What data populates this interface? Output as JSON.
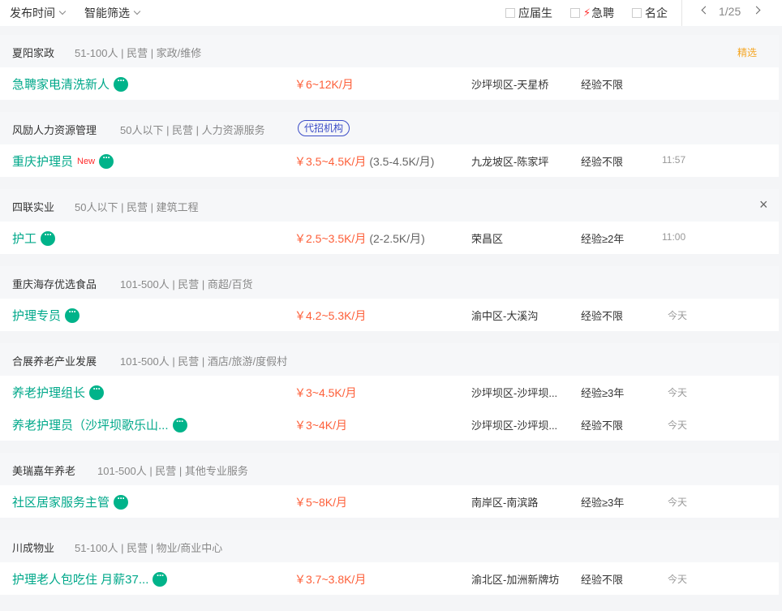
{
  "filters": {
    "publish_time": "发布时间",
    "smart_filter": "智能筛选",
    "fresh_grad": "应届生",
    "urgent": "急聘",
    "famous": "名企",
    "page": "1/25"
  },
  "cards": [
    {
      "company": "夏阳家政",
      "meta": "51-100人 | 民营 | 家政/维修",
      "featured": "精选",
      "jobs": [
        {
          "title": "急聘家电清洗新人",
          "salary": "￥6~12K/月",
          "location": "沙坪坝区-天星桥",
          "experience": "经验不限"
        }
      ]
    },
    {
      "company": "风励人力资源管理",
      "meta": "50人以下 | 民营 | 人力资源服务",
      "agency": "代招机构",
      "jobs": [
        {
          "title": "重庆护理员",
          "new": "New",
          "salary": "￥3.5~4.5K/月",
          "salary_sub": "(3.5-4.5K/月)",
          "location": "九龙坡区-陈家坪",
          "experience": "经验不限",
          "time": "11:57"
        }
      ]
    },
    {
      "company": "四联实业",
      "meta": "50人以下 | 民营 | 建筑工程",
      "close": "×",
      "jobs": [
        {
          "title": "护工",
          "salary": "￥2.5~3.5K/月",
          "salary_sub": "(2-2.5K/月)",
          "location": "荣昌区",
          "experience": "经验≥2年",
          "time": "11:00"
        }
      ]
    },
    {
      "company": "重庆海存优选食品",
      "meta": "101-500人 | 民营 | 商超/百货",
      "jobs": [
        {
          "title": "护理专员",
          "salary": "￥4.2~5.3K/月",
          "location": "渝中区-大溪沟",
          "experience": "经验不限",
          "time": "今天"
        }
      ]
    },
    {
      "company": "合展养老产业发展",
      "meta": "101-500人 | 民营 | 酒店/旅游/度假村",
      "jobs": [
        {
          "title": "养老护理组长",
          "salary": "￥3~4.5K/月",
          "location": "沙坪坝区-沙坪坝...",
          "experience": "经验≥3年",
          "time": "今天"
        },
        {
          "title": "养老护理员（沙坪坝歌乐山...",
          "salary": "￥3~4K/月",
          "location": "沙坪坝区-沙坪坝...",
          "experience": "经验不限",
          "time": "今天"
        }
      ]
    },
    {
      "company": "美瑞嘉年养老",
      "meta": "101-500人 | 民营 | 其他专业服务",
      "jobs": [
        {
          "title": "社区居家服务主管",
          "salary": "￥5~8K/月",
          "location": "南岸区-南滨路",
          "experience": "经验≥3年",
          "time": "今天"
        }
      ]
    },
    {
      "company": "川成物业",
      "meta": "51-100人 | 民营 | 物业/商业中心",
      "jobs": [
        {
          "title": "护理老人包吃住 月薪37...",
          "salary": "￥3.7~3.8K/月",
          "location": "渝北区-加洲新牌坊",
          "experience": "经验不限",
          "time": "今天"
        }
      ]
    }
  ]
}
